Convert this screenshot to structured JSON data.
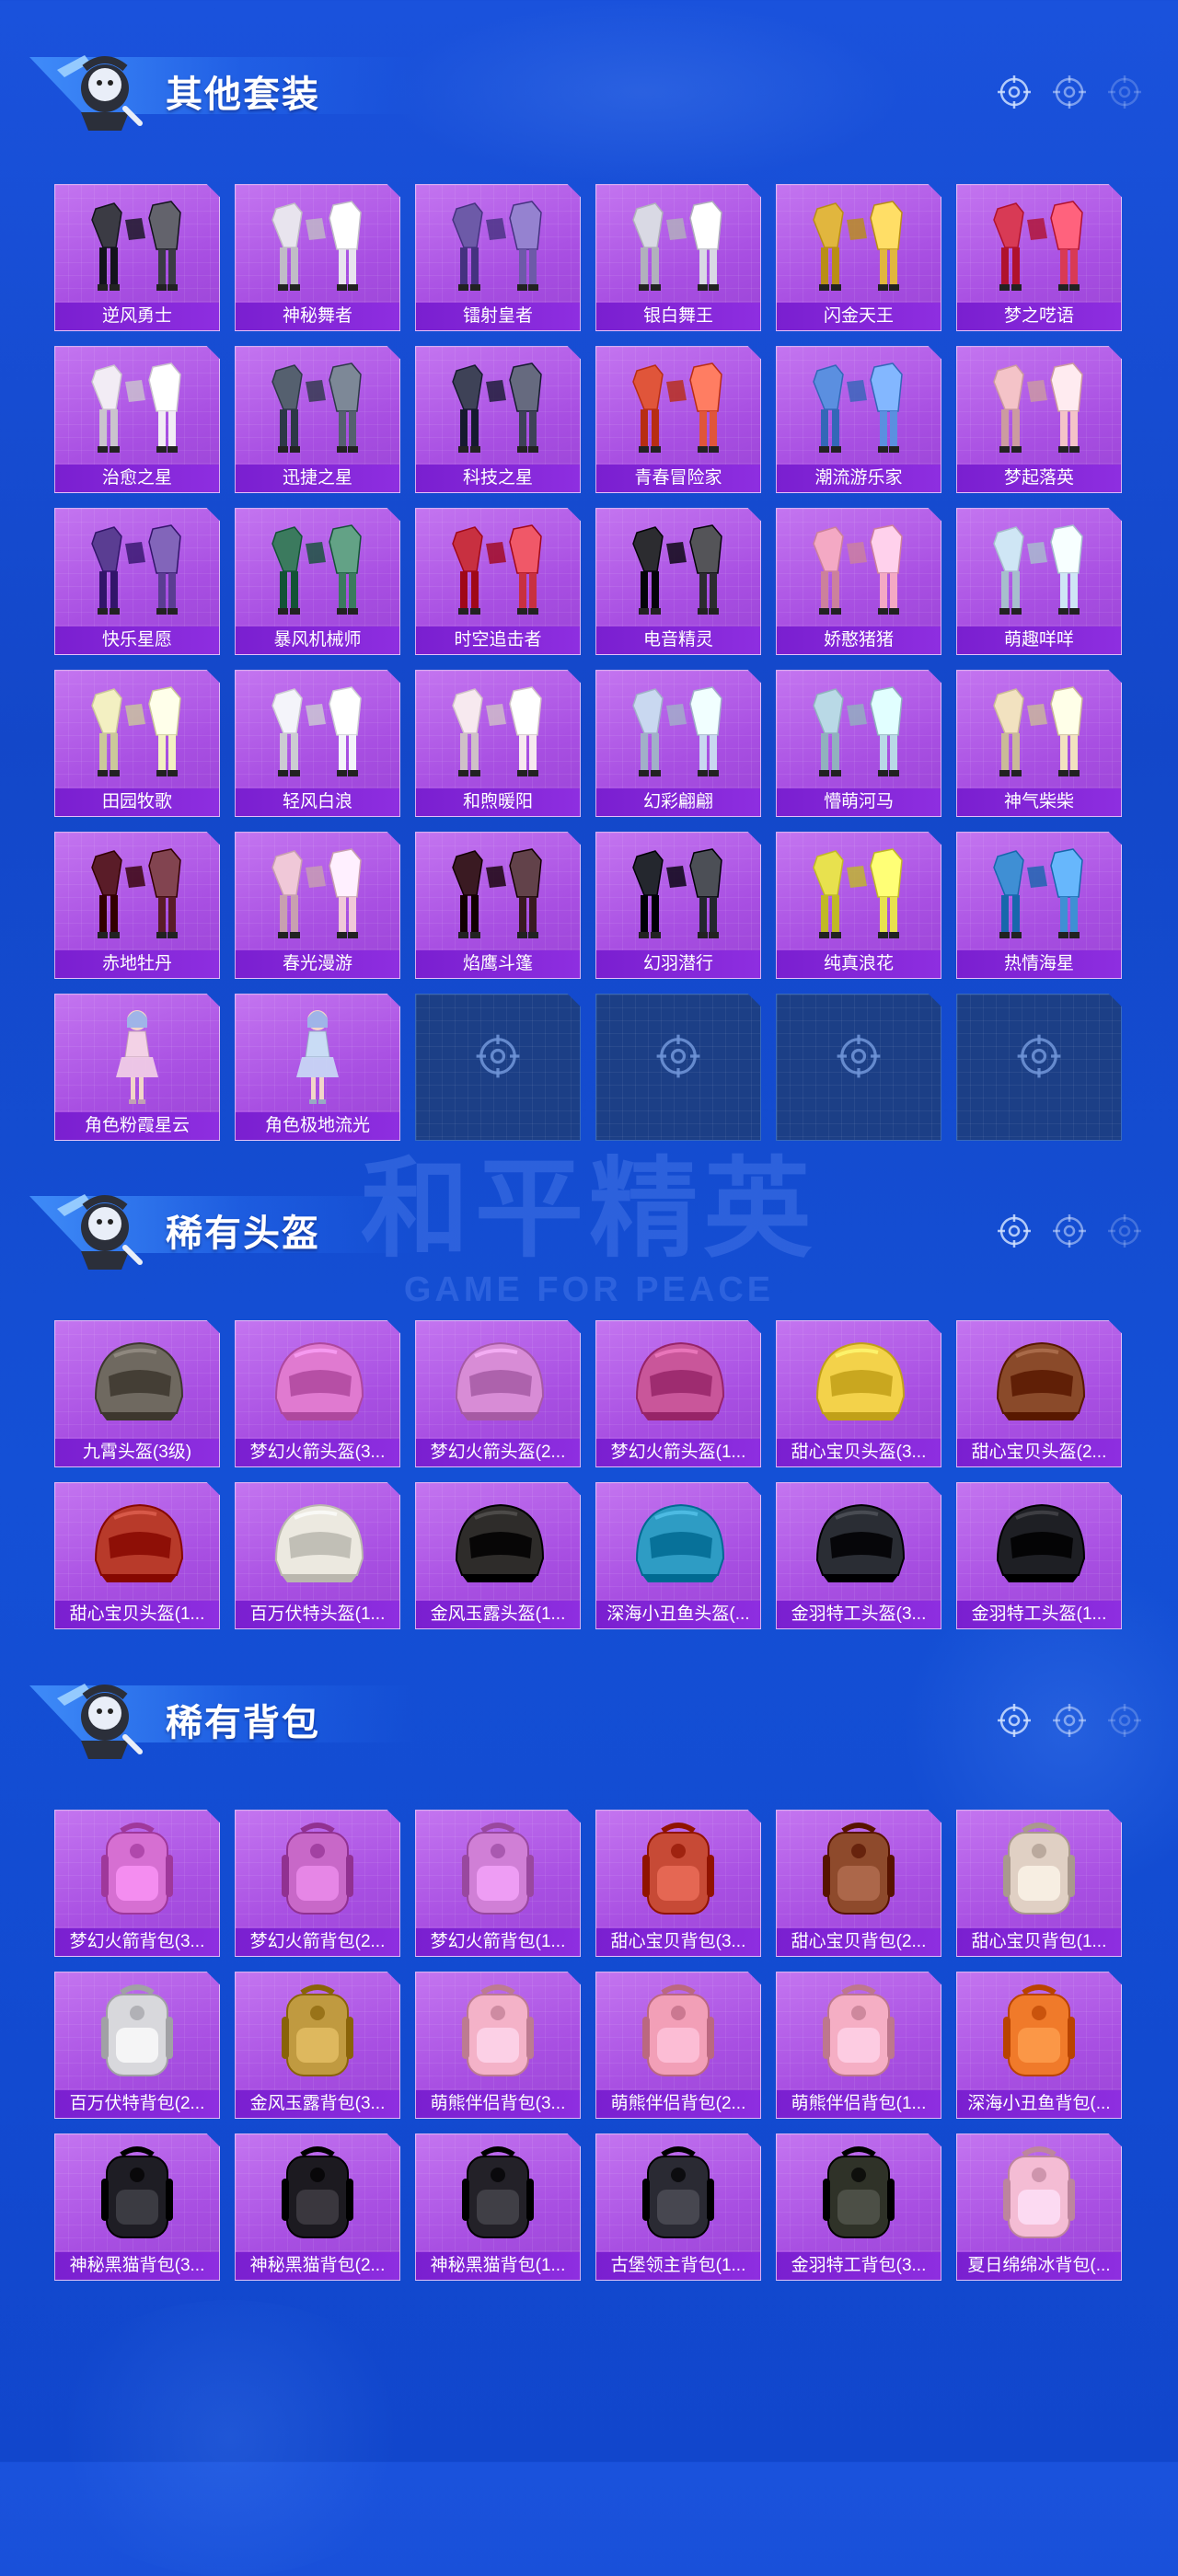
{
  "watermark": {
    "main": "和平精英",
    "sub": "GAME FOR PEACE"
  },
  "colors": {
    "card_bg": "#b05fe8",
    "label_bg": "#7a1fd0",
    "empty_bg": "#1c3f86",
    "page_bg": "#1450d6"
  },
  "sections": [
    {
      "title": "其他套装",
      "items": [
        {
          "label": "逆风勇士",
          "icon": "outfit-icon",
          "tone": "#3b3b44"
        },
        {
          "label": "神秘舞者",
          "icon": "outfit-icon",
          "tone": "#e8e4ee"
        },
        {
          "label": "镭射皇者",
          "icon": "outfit-icon",
          "tone": "#6d5aa8"
        },
        {
          "label": "银白舞王",
          "icon": "outfit-icon",
          "tone": "#d9d9e4"
        },
        {
          "label": "闪金天王",
          "icon": "outfit-icon",
          "tone": "#e1b63e"
        },
        {
          "label": "梦之呓语",
          "icon": "outfit-icon",
          "tone": "#d83a55"
        },
        {
          "label": "治愈之星",
          "icon": "outfit-icon",
          "tone": "#f2ecf5"
        },
        {
          "label": "迅捷之星",
          "icon": "outfit-icon",
          "tone": "#55606f"
        },
        {
          "label": "科技之星",
          "icon": "outfit-icon",
          "tone": "#3e4257"
        },
        {
          "label": "青春冒险家",
          "icon": "outfit-icon",
          "tone": "#e0553a"
        },
        {
          "label": "潮流游乐家",
          "icon": "outfit-icon",
          "tone": "#5b8fe0"
        },
        {
          "label": "梦起落英",
          "icon": "outfit-icon",
          "tone": "#f4c3c8"
        },
        {
          "label": "快乐星愿",
          "icon": "outfit-icon",
          "tone": "#5a3d92"
        },
        {
          "label": "暴风机械师",
          "icon": "outfit-icon",
          "tone": "#3b7a5e"
        },
        {
          "label": "时空追击者",
          "icon": "outfit-icon",
          "tone": "#c83040"
        },
        {
          "label": "电音精灵",
          "icon": "outfit-icon",
          "tone": "#2c2c30"
        },
        {
          "label": "娇憨猪猪",
          "icon": "outfit-icon",
          "tone": "#f4a9c4"
        },
        {
          "label": "萌趣咩咩",
          "icon": "outfit-icon",
          "tone": "#cfe6f5"
        },
        {
          "label": "田园牧歌",
          "icon": "outfit-icon",
          "tone": "#f3f0c2"
        },
        {
          "label": "轻风白浪",
          "icon": "outfit-icon",
          "tone": "#f4f4fa"
        },
        {
          "label": "和煦暖阳",
          "icon": "outfit-icon",
          "tone": "#f7e9ef"
        },
        {
          "label": "幻彩翩翩",
          "icon": "outfit-icon",
          "tone": "#c9d8f0"
        },
        {
          "label": "懵萌河马",
          "icon": "outfit-icon",
          "tone": "#b9d9e6"
        },
        {
          "label": "神气柴柴",
          "icon": "outfit-icon",
          "tone": "#f2e2c0"
        },
        {
          "label": "赤地牡丹",
          "icon": "outfit-icon",
          "tone": "#5a1c28"
        },
        {
          "label": "春光漫游",
          "icon": "outfit-icon",
          "tone": "#f0c8d8"
        },
        {
          "label": "焰鹰斗篷",
          "icon": "outfit-icon",
          "tone": "#3a1a22"
        },
        {
          "label": "幻羽潜行",
          "icon": "outfit-icon",
          "tone": "#24272e"
        },
        {
          "label": "纯真浪花",
          "icon": "outfit-icon",
          "tone": "#e8e14e"
        },
        {
          "label": "热情海星",
          "icon": "outfit-icon",
          "tone": "#3f8fd4"
        },
        {
          "label": "角色粉霞星云",
          "icon": "character-icon",
          "tone": "#f3d2e6"
        },
        {
          "label": "角色极地流光",
          "icon": "character-icon",
          "tone": "#c9dcf5"
        },
        {
          "label": "",
          "icon": "crosshair-icon",
          "empty": true
        },
        {
          "label": "",
          "icon": "crosshair-icon",
          "empty": true
        },
        {
          "label": "",
          "icon": "crosshair-icon",
          "empty": true
        },
        {
          "label": "",
          "icon": "crosshair-icon",
          "empty": true
        }
      ]
    },
    {
      "title": "稀有头盔",
      "items": [
        {
          "label": "九霄头盔(3级)",
          "icon": "helmet-icon",
          "tone": "#6f6960"
        },
        {
          "label": "梦幻火箭头盔(3...",
          "icon": "helmet-icon",
          "tone": "#e07ad0"
        },
        {
          "label": "梦幻火箭头盔(2...",
          "icon": "helmet-icon",
          "tone": "#d88cd6"
        },
        {
          "label": "梦幻火箭头盔(1...",
          "icon": "helmet-icon",
          "tone": "#c9569a"
        },
        {
          "label": "甜心宝贝头盔(3...",
          "icon": "helmet-icon",
          "tone": "#f3d24a"
        },
        {
          "label": "甜心宝贝头盔(2...",
          "icon": "helmet-icon",
          "tone": "#8a4a2a"
        },
        {
          "label": "甜心宝贝头盔(1...",
          "icon": "helmet-icon",
          "tone": "#b83a2a"
        },
        {
          "label": "百万伏特头盔(1...",
          "icon": "helmet-icon",
          "tone": "#ece9e0"
        },
        {
          "label": "金风玉露头盔(1...",
          "icon": "helmet-icon",
          "tone": "#2e2c2a"
        },
        {
          "label": "深海小丑鱼头盔(...",
          "icon": "helmet-icon",
          "tone": "#2e9cc4"
        },
        {
          "label": "金羽特工头盔(3...",
          "icon": "helmet-icon",
          "tone": "#2a2d34"
        },
        {
          "label": "金羽特工头盔(1...",
          "icon": "helmet-icon",
          "tone": "#1e1f24"
        }
      ]
    },
    {
      "title": "稀有背包",
      "items": [
        {
          "label": "梦幻火箭背包(3...",
          "icon": "backpack-icon",
          "tone": "#d66fd2"
        },
        {
          "label": "梦幻火箭背包(2...",
          "icon": "backpack-icon",
          "tone": "#c868c8"
        },
        {
          "label": "梦幻火箭背包(1...",
          "icon": "backpack-icon",
          "tone": "#d07fd6"
        },
        {
          "label": "甜心宝贝背包(3...",
          "icon": "backpack-icon",
          "tone": "#c74a36"
        },
        {
          "label": "甜心宝贝背包(2...",
          "icon": "backpack-icon",
          "tone": "#8e4a2c"
        },
        {
          "label": "甜心宝贝背包(1...",
          "icon": "backpack-icon",
          "tone": "#e0d0c4"
        },
        {
          "label": "百万伏特背包(2...",
          "icon": "backpack-icon",
          "tone": "#d8d8dc"
        },
        {
          "label": "金风玉露背包(3...",
          "icon": "backpack-icon",
          "tone": "#c09a40"
        },
        {
          "label": "萌熊伴侣背包(3...",
          "icon": "backpack-icon",
          "tone": "#f4b2c8"
        },
        {
          "label": "萌熊伴侣背包(2...",
          "icon": "backpack-icon",
          "tone": "#f29fb7"
        },
        {
          "label": "萌熊伴侣背包(1...",
          "icon": "backpack-icon",
          "tone": "#f5aec4"
        },
        {
          "label": "深海小丑鱼背包(...",
          "icon": "backpack-icon",
          "tone": "#f07a2a"
        },
        {
          "label": "神秘黑猫背包(3...",
          "icon": "backpack-icon",
          "tone": "#1e1d24"
        },
        {
          "label": "神秘黑猫背包(2...",
          "icon": "backpack-icon",
          "tone": "#1c1a20"
        },
        {
          "label": "神秘黑猫背包(1...",
          "icon": "backpack-icon",
          "tone": "#232128"
        },
        {
          "label": "古堡领主背包(1...",
          "icon": "backpack-icon",
          "tone": "#2a2a33"
        },
        {
          "label": "金羽特工背包(3...",
          "icon": "backpack-icon",
          "tone": "#2f3228"
        },
        {
          "label": "夏日绵绵冰背包(...",
          "icon": "backpack-icon",
          "tone": "#f4bcd4"
        }
      ]
    }
  ]
}
